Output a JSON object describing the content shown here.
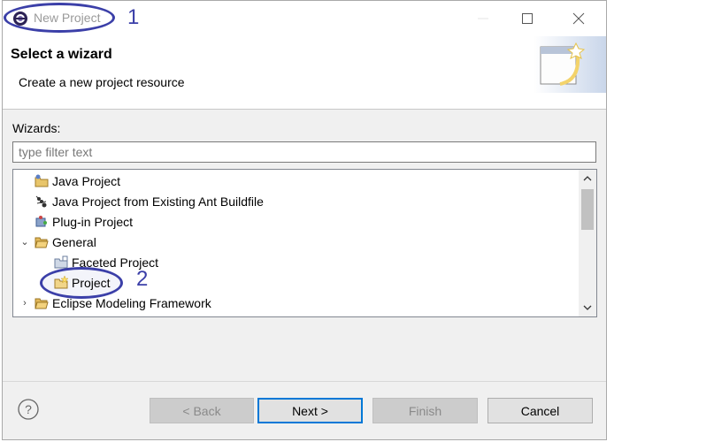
{
  "window": {
    "title": "New Project",
    "annotations": {
      "title_marker": "1",
      "project_marker": "2"
    }
  },
  "header": {
    "title": "Select a wizard",
    "description": "Create a new project resource"
  },
  "wizards": {
    "label": "Wizards:",
    "filter_placeholder": "type filter text",
    "items": [
      {
        "label": "Java Project",
        "icon": "java-project-icon"
      },
      {
        "label": "Java Project from Existing Ant Buildfile",
        "icon": "ant-icon"
      },
      {
        "label": "Plug-in Project",
        "icon": "plugin-icon"
      },
      {
        "label": "General",
        "icon": "folder-open-icon",
        "expanded": true
      },
      {
        "label": "Faceted Project",
        "icon": "faceted-project-icon"
      },
      {
        "label": "Project",
        "icon": "project-icon",
        "selected": true
      },
      {
        "label": "Eclipse Modeling Framework",
        "icon": "folder-open-icon",
        "expanded": false
      }
    ]
  },
  "buttons": {
    "back": "< Back",
    "next": "Next >",
    "finish": "Finish",
    "cancel": "Cancel"
  },
  "colors": {
    "annotation": "#3b3fa8",
    "accent": "#0078d7"
  }
}
